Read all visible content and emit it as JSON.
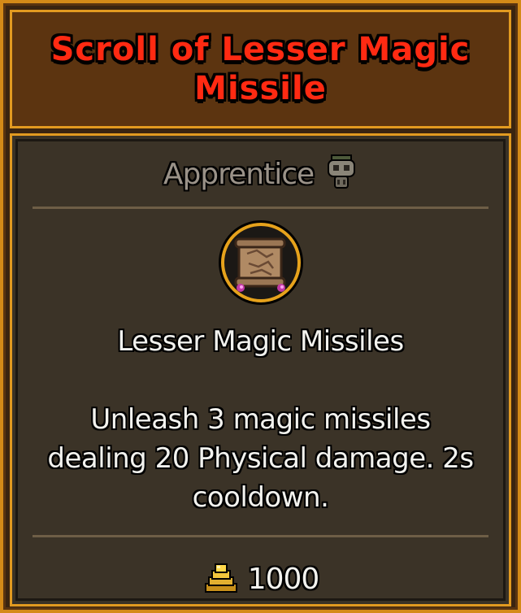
{
  "item": {
    "title": "Scroll of Lesser Magic Missile",
    "rank": "Apprentice",
    "rank_icon": "skull-helmet-icon",
    "spell_icon": "scroll-icon",
    "spell_name": "Lesser Magic Missiles",
    "description": "Unleash 3 magic missiles dealing 20 Physical damage. 2s cooldown.",
    "price": "1000",
    "price_icon": "gold-coins-icon"
  },
  "colors": {
    "title": "#ff2a12",
    "border": "#e29a20",
    "panel": "#3b3327",
    "rank_text": "#9a9288",
    "body_text": "#f2f2ee"
  }
}
